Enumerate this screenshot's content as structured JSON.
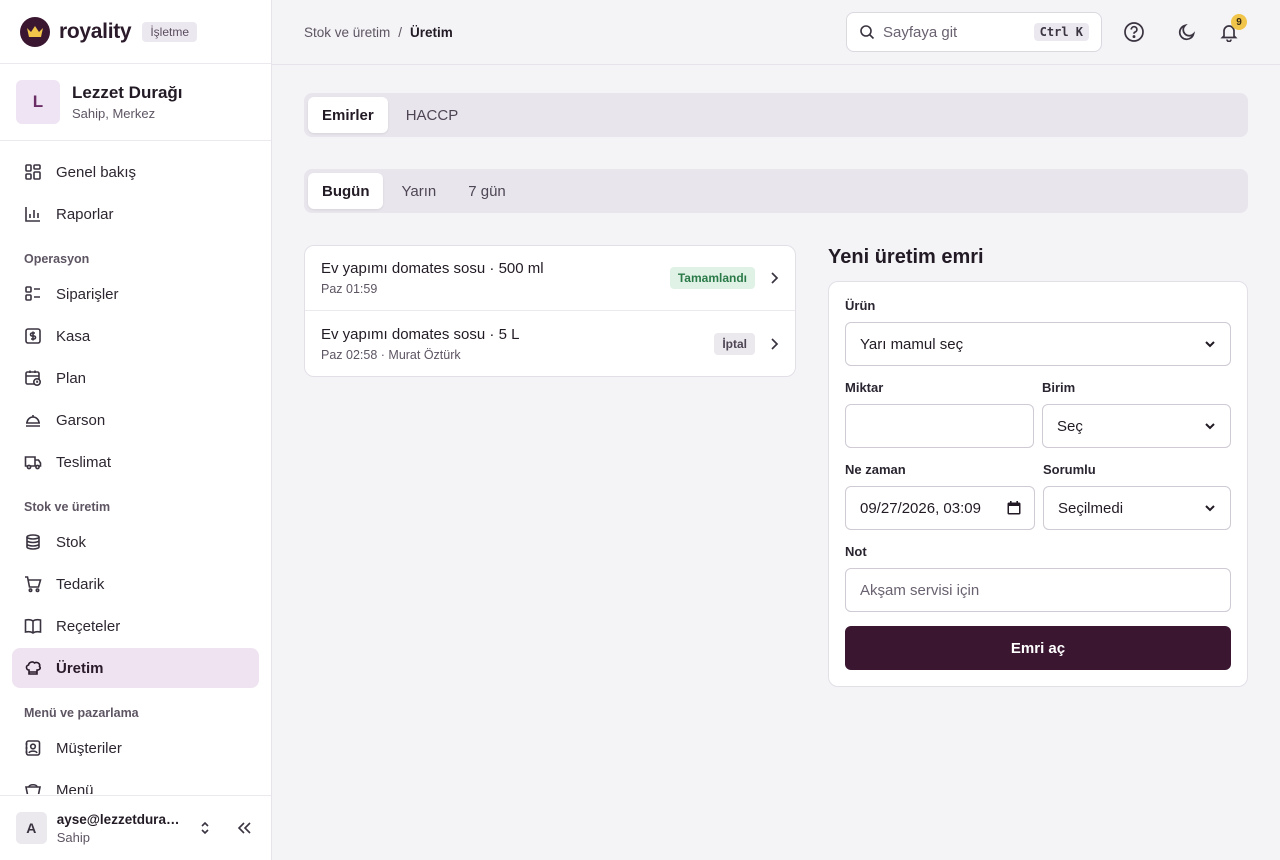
{
  "brand": {
    "name": "royality",
    "badge": "İşletme"
  },
  "org": {
    "initial": "L",
    "name": "Lezzet Durağı",
    "role": "Sahip, Merkez"
  },
  "nav": {
    "top": [
      {
        "label": "Genel bakış",
        "icon": "grid-icon"
      },
      {
        "label": "Raporlar",
        "icon": "bar-chart-icon"
      }
    ],
    "operasyon": {
      "title": "Operasyon",
      "items": [
        {
          "label": "Siparişler",
          "icon": "list-icon"
        },
        {
          "label": "Kasa",
          "icon": "cash-icon"
        },
        {
          "label": "Plan",
          "icon": "calendar-clock-icon"
        },
        {
          "label": "Garson",
          "icon": "waiter-icon"
        },
        {
          "label": "Teslimat",
          "icon": "truck-icon"
        }
      ]
    },
    "stok": {
      "title": "Stok ve üretim",
      "items": [
        {
          "label": "Stok",
          "icon": "database-icon"
        },
        {
          "label": "Tedarik",
          "icon": "cart-icon"
        },
        {
          "label": "Reçeteler",
          "icon": "book-icon"
        },
        {
          "label": "Üretim",
          "icon": "chef-hat-icon"
        }
      ]
    },
    "menu": {
      "title": "Menü ve pazarlama",
      "items": [
        {
          "label": "Müşteriler",
          "icon": "contact-icon"
        },
        {
          "label": "Menü",
          "icon": "menu-book-icon"
        }
      ]
    }
  },
  "user": {
    "initial": "A",
    "email": "ayse@lezzetduragi.com",
    "role": "Sahip"
  },
  "header": {
    "breadcrumb_parent": "Stok ve üretim",
    "breadcrumb_sep": "/",
    "breadcrumb_current": "Üretim",
    "search_placeholder": "Sayfaya git",
    "search_shortcut": "Ctrl K",
    "notification_count": "9"
  },
  "main_tabs": [
    "Emirler",
    "HACCP"
  ],
  "day_tabs": [
    "Bugün",
    "Yarın",
    "7 gün"
  ],
  "orders": [
    {
      "title": "Ev yapımı domates sosu · 500 ml",
      "meta": "Paz 01:59",
      "status": "Tamamlandı"
    },
    {
      "title": "Ev yapımı domates sosu · 5 L",
      "meta": "Paz 02:58 · Murat Öztürk",
      "status": "İptal"
    }
  ],
  "form": {
    "title": "Yeni üretim emri",
    "product_label": "Ürün",
    "product_value": "Yarı mamul seç",
    "quantity_label": "Miktar",
    "quantity_value": "",
    "unit_label": "Birim",
    "unit_value": "Seç",
    "when_label": "Ne zaman",
    "when_value": "09/27/2026, 03:09",
    "responsible_label": "Sorumlu",
    "responsible_value": "Seçilmedi",
    "note_label": "Not",
    "note_placeholder": "Akşam servisi için",
    "submit_label": "Emri aç"
  },
  "colors": {
    "brand": "#3a1631",
    "active_nav": "#efe3f1",
    "done": "#2a7a48",
    "badge": "#f0c54a"
  }
}
